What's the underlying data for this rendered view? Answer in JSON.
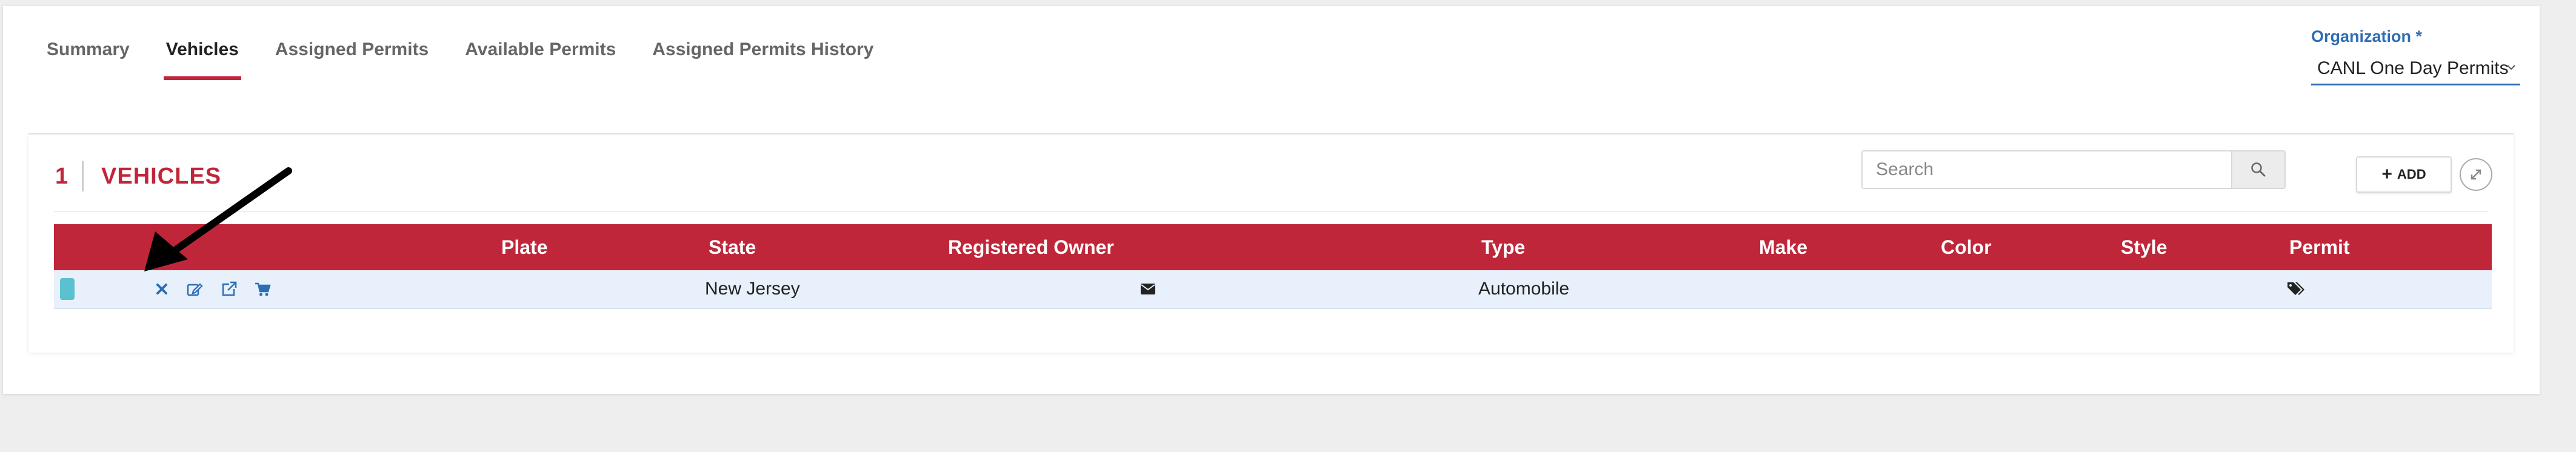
{
  "tabs": [
    {
      "label": "Summary",
      "active": false
    },
    {
      "label": "Vehicles",
      "active": true
    },
    {
      "label": "Assigned Permits",
      "active": false
    },
    {
      "label": "Available Permits",
      "active": false
    },
    {
      "label": "Assigned Permits History",
      "active": false
    }
  ],
  "organization": {
    "label": "Organization *",
    "selected": "CANL One Day Permits"
  },
  "panel": {
    "count": "1",
    "title": "VEHICLES",
    "search": {
      "placeholder": "Search",
      "value": ""
    },
    "add_label": "ADD"
  },
  "table": {
    "columns": [
      "Plate",
      "State",
      "Registered Owner",
      "Type",
      "Make",
      "Color",
      "Style",
      "Permit"
    ],
    "rows": [
      {
        "plate": "",
        "state": "New Jersey",
        "registered_owner_icon": "envelope-icon",
        "type": "Automobile",
        "make": "",
        "color": "",
        "style": "",
        "permit_icon": "tags-icon",
        "actions": [
          "delete-icon",
          "edit-icon",
          "external-link-icon",
          "cart-icon"
        ]
      }
    ]
  },
  "colors": {
    "brand_red": "#c0263a",
    "link_blue": "#2d6db5",
    "row_highlight": "#e8f1fb",
    "row_selector": "#5bc0cf",
    "page_background": "#eeeeee"
  }
}
